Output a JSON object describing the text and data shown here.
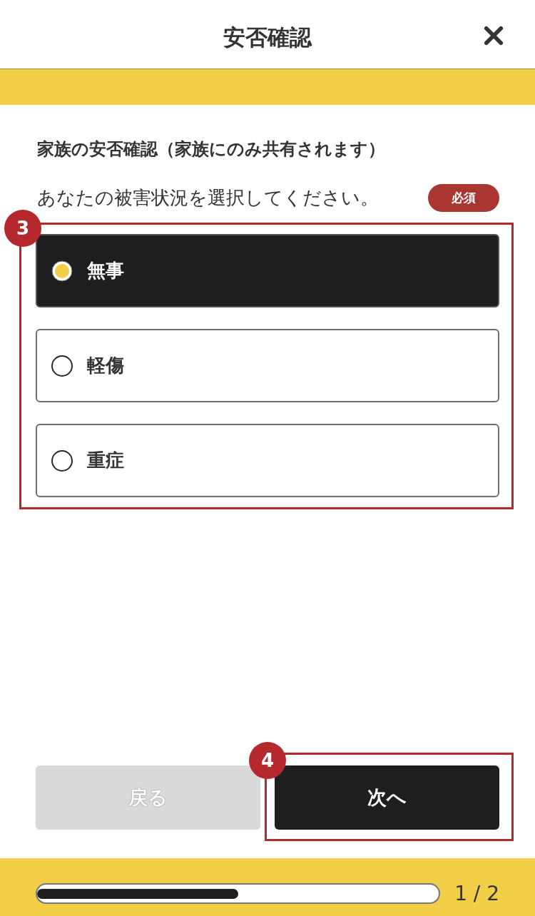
{
  "header": {
    "title": "安否確認"
  },
  "section": {
    "title": "家族の安否確認（家族にのみ共有されます）"
  },
  "question": {
    "text": "あなたの被害状況を選択してください。",
    "required_badge": "必須"
  },
  "choices": {
    "annotation": "3",
    "options": [
      {
        "label": "無事",
        "selected": true
      },
      {
        "label": "軽傷",
        "selected": false
      },
      {
        "label": "重症",
        "selected": false
      }
    ]
  },
  "buttons": [
    {
      "label": "戻る",
      "disabled": true
    },
    {
      "label": "次へ",
      "disabled": false,
      "annotation": "4"
    }
  ],
  "progress": {
    "level": 0.5,
    "reading": "1 / 2"
  }
}
